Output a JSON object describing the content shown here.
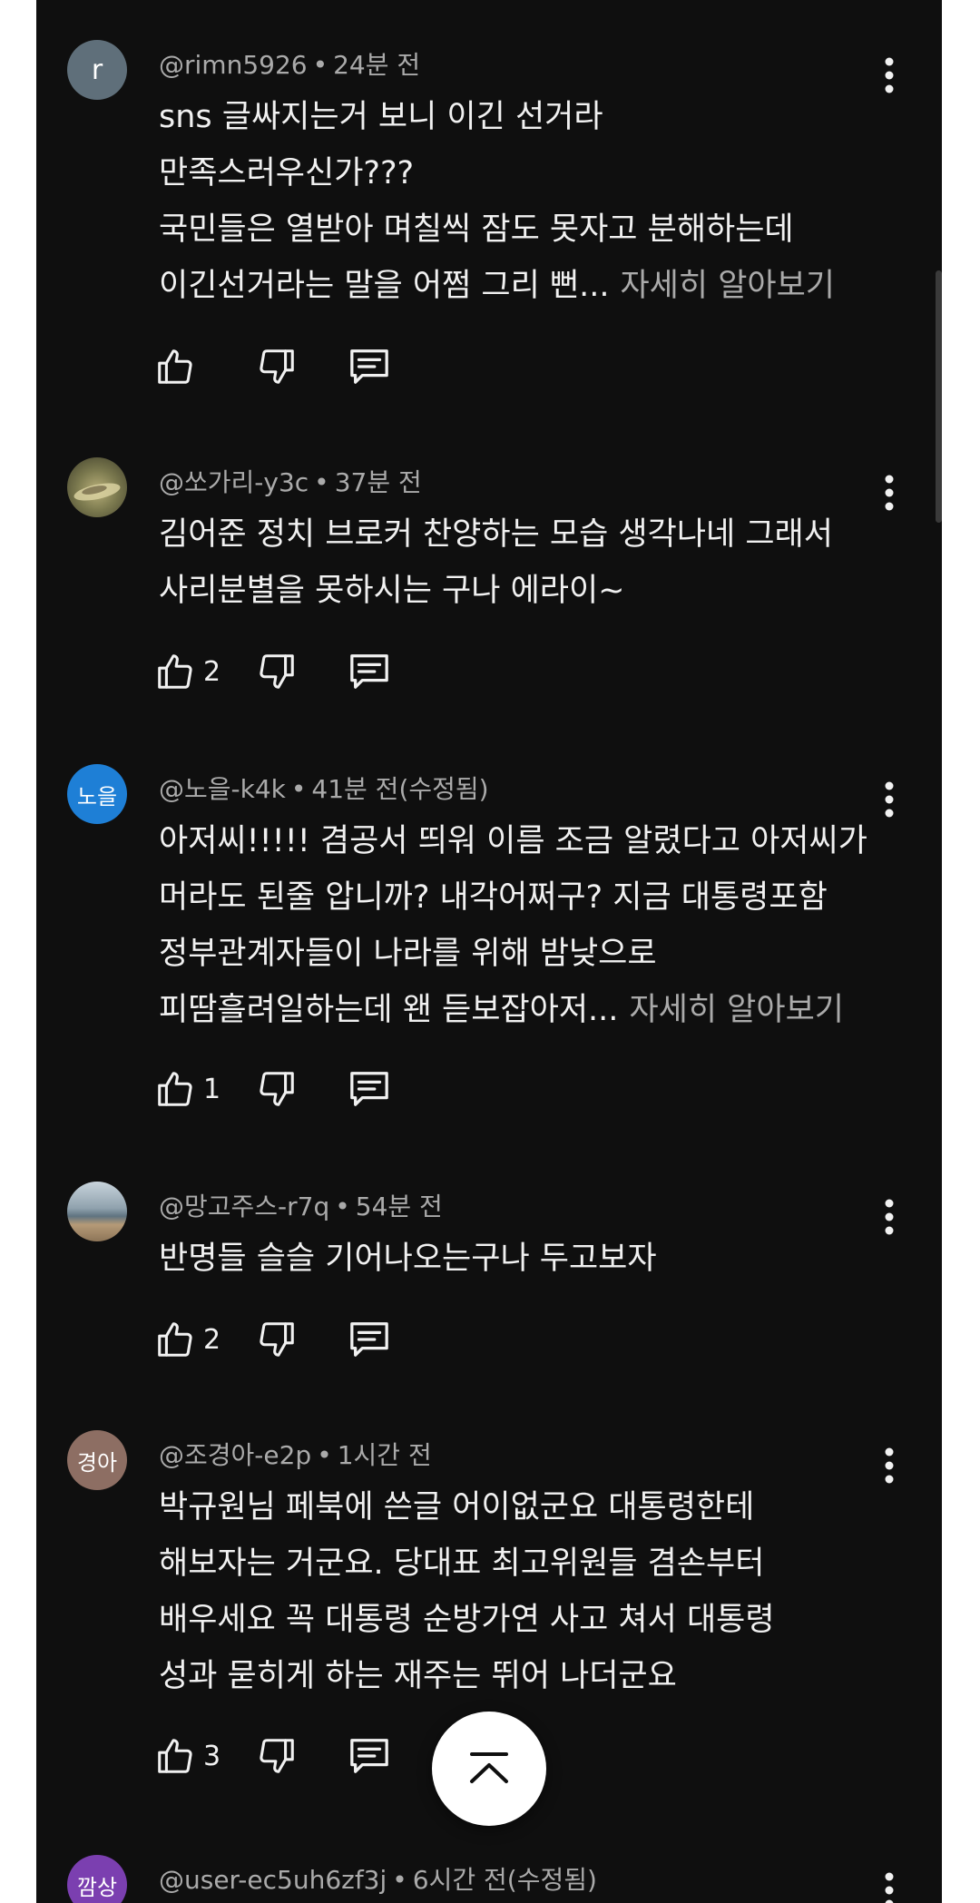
{
  "comments": [
    {
      "avatar_text": "r",
      "avatar_color": "#5f6f7a",
      "handle": "@rimn5926",
      "time": "24분 전",
      "lines": [
        "sns 글싸지는거 보니 이긴 선거라",
        "만족스러우신가???",
        "국민들은 열받아 며칠씩 잠도 못자고 분해하는데",
        "이긴선거라는 말을 어쩜 그리 뻔..."
      ],
      "more": "자세히 알아보기",
      "likes": ""
    },
    {
      "avatar_text": "",
      "avatar_color": "#6b6a48",
      "handle": "@쏘가리-y3c",
      "time": "37분 전",
      "lines": [
        "김어준 정치 브로커 찬양하는 모습 생각나네 그래서",
        "사리분별을 못하시는 구나 에라이~"
      ],
      "more": "",
      "likes": "2"
    },
    {
      "avatar_text": "노을",
      "avatar_color": "#1e7fd6",
      "handle": "@노을-k4k",
      "time": "41분 전(수정됨)",
      "lines": [
        "아저씨!!!!! 겸공서 띄워 이름 조금 알렸다고 아저씨가",
        "머라도 된줄 압니까?  내각어쩌구? 지금 대통령포함",
        "정부관계자들이 나라를 위해 밤낮으로",
        "피땀흘려일하는데 왠 듣보잡아저..."
      ],
      "more": "자세히 알아보기",
      "likes": "1"
    },
    {
      "avatar_text": "",
      "avatar_color": "#8a9aa6",
      "handle": "@망고주스-r7q",
      "time": "54분 전",
      "lines": [
        "반명들 슬슬 기어나오는구나 두고보자"
      ],
      "more": "",
      "likes": "2"
    },
    {
      "avatar_text": "경아",
      "avatar_color": "#8d6e63",
      "handle": "@조경아-e2p",
      "time": "1시간 전",
      "lines": [
        "박규원님 페북에 쓴글  어이없군요   대통령한테",
        "해보자는 거군요.  당대표 최고위원들   겸손부터",
        "배우세요  꼭 대통령 순방가연  사고 쳐서  대통령",
        "성과 묻히게 하는 재주는 뛰어 나더군요"
      ],
      "more": "",
      "likes": "3"
    },
    {
      "avatar_text": "깜상",
      "avatar_color": "#7b3fb0",
      "handle": "@user-ec5uh6zf3j",
      "time": "6시간 전(수정됨)",
      "lines": [],
      "more": "",
      "likes": ""
    }
  ],
  "icons": {
    "like": "thumbs-up-icon",
    "dislike": "thumbs-down-icon",
    "reply": "reply-icon",
    "menu": "more-vert-icon",
    "scroll_top": "chevron-up-icon"
  }
}
